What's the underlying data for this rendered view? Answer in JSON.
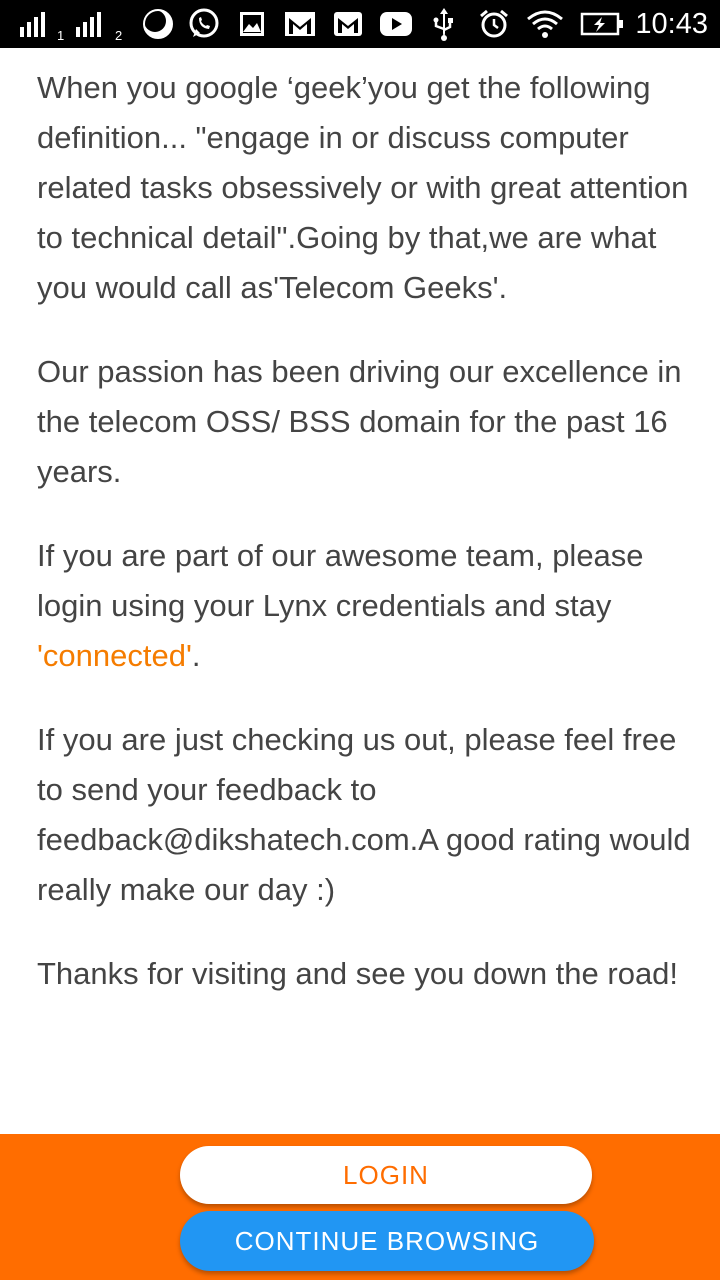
{
  "status_bar": {
    "sim1_label": "1",
    "sim2_label": "2",
    "time": "10:43",
    "icons": [
      "signal-sim1-icon",
      "signal-sim2-icon",
      "do-not-disturb-moon-icon",
      "whatsapp-icon",
      "gallery-icon",
      "gmail-icon",
      "gmail-icon",
      "youtube-icon",
      "usb-icon",
      "alarm-icon",
      "wifi-icon",
      "battery-charging-icon"
    ]
  },
  "content": {
    "paragraph1": "When you google ‘geek’you get the following definition... \"engage in or discuss computer related tasks obsessively or with great attention to technical detail\".Going by that,we are what you would call as'Telecom Geeks'.",
    "paragraph2": "Our passion has been driving our excellence in the telecom OSS/ BSS domain for the past 16 years.",
    "paragraph3_before": "If you are part of our awesome team, please login using your Lynx credentials and stay ",
    "paragraph3_highlight": "'connected'",
    "paragraph3_after": ".",
    "paragraph4": "If you are just checking us out, please feel free to send your feedback to feedback@dikshatech.com.A good rating would really make our day :)",
    "paragraph5": "Thanks for visiting and see you down the road!"
  },
  "buttons": {
    "login_label": "LOGIN",
    "continue_label": "CONTINUE BROWSING"
  },
  "colors": {
    "accent_orange": "#ff6d00",
    "link_orange": "#f57c00",
    "button_blue": "#2196f3",
    "body_text": "#444444",
    "status_bar_bg": "#000000"
  }
}
